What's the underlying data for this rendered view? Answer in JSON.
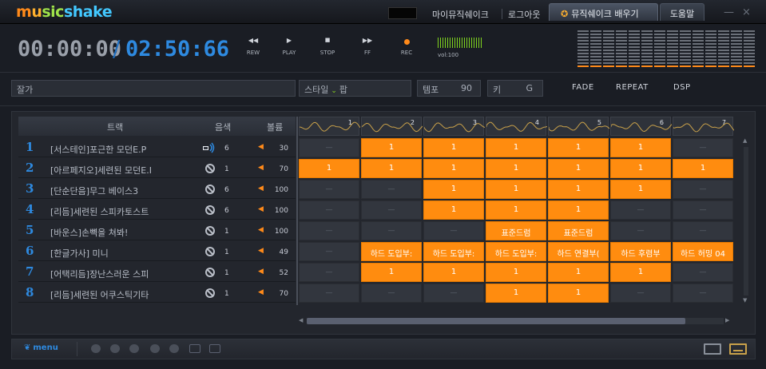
{
  "app": {
    "logo": "musicshake",
    "top_links": [
      "마이뮤직쉐이크",
      "로그아웃"
    ],
    "learn_tab": "뮤직쉐이크 배우기",
    "help_tab": "도움말",
    "win_minimize": "—",
    "win_close": "×"
  },
  "transport": {
    "current_time": "00:00:00",
    "separator": "/",
    "total_time": "02:50:66",
    "buttons": [
      {
        "icon": "rewind-icon",
        "glyph": "◀◀",
        "label": "REW"
      },
      {
        "icon": "play-icon",
        "glyph": "▶",
        "label": "PLAY"
      },
      {
        "icon": "stop-icon",
        "glyph": "■",
        "label": "STOP"
      },
      {
        "icon": "fast-forward-icon",
        "glyph": "▶▶",
        "label": "FF"
      },
      {
        "icon": "record-icon",
        "glyph": "●",
        "label": "REC"
      }
    ],
    "volume_label": "vol:100",
    "volume_level": 1.0
  },
  "info": {
    "song_name": "잘가",
    "style_label": "스타일",
    "style_value": "팝",
    "tempo_label": "템포",
    "tempo_value": "90",
    "key_label": "키",
    "key_value": "G",
    "options": [
      "FADE",
      "REPEAT",
      "DSP"
    ]
  },
  "header": {
    "track": "트랙",
    "instrument": "음색",
    "volume": "볼륨"
  },
  "columns": [
    "1",
    "2",
    "3",
    "4",
    "5",
    "6",
    "7"
  ],
  "tracks": [
    {
      "num": "1",
      "name": "[서스테인]포근한 모던E.P",
      "inst": "6",
      "vol": "30",
      "muted": false,
      "cells": [
        "—",
        "1",
        "1",
        "1",
        "1",
        "1",
        "—"
      ]
    },
    {
      "num": "2",
      "name": "[아르페지오]세련된 모던E.I",
      "inst": "1",
      "vol": "70",
      "muted": true,
      "cells": [
        "1",
        "1",
        "1",
        "1",
        "1",
        "1",
        "1"
      ]
    },
    {
      "num": "3",
      "name": "[단순단음]무그 베이스3",
      "inst": "6",
      "vol": "100",
      "muted": true,
      "cells": [
        "—",
        "—",
        "1",
        "1",
        "1",
        "1",
        "—"
      ]
    },
    {
      "num": "4",
      "name": "[리듬]세련된 스피카토스트",
      "inst": "6",
      "vol": "100",
      "muted": true,
      "cells": [
        "—",
        "—",
        "1",
        "1",
        "1",
        "—",
        "—"
      ]
    },
    {
      "num": "5",
      "name": "[바운스]손뼉을 쳐봐!",
      "inst": "1",
      "vol": "100",
      "muted": true,
      "cells": [
        "—",
        "—",
        "—",
        "표준드럼",
        "표준드럼",
        "—",
        "—"
      ]
    },
    {
      "num": "6",
      "name": "[한글가사] 미니",
      "inst": "1",
      "vol": "49",
      "muted": true,
      "cells": [
        "—",
        "하드 도입부:",
        "하드 도입부:",
        "하드 도입부:",
        "하드 연결부(",
        "하드 후렴부",
        "하드 허밍 04"
      ]
    },
    {
      "num": "7",
      "name": "[어택리듬]장난스러운 스피",
      "inst": "1",
      "vol": "52",
      "muted": true,
      "cells": [
        "—",
        "1",
        "1",
        "1",
        "1",
        "1",
        "—"
      ]
    },
    {
      "num": "8",
      "name": "[리듬]세련된 어쿠스틱기타",
      "inst": "1",
      "vol": "70",
      "muted": true,
      "cells": [
        "—",
        "—",
        "—",
        "1",
        "1",
        "—",
        "—"
      ]
    }
  ],
  "bottom": {
    "menu_label": "menu"
  },
  "colors": {
    "accent": "#ff8c0f",
    "blue": "#2e8ae0",
    "green": "#7fd41f"
  }
}
